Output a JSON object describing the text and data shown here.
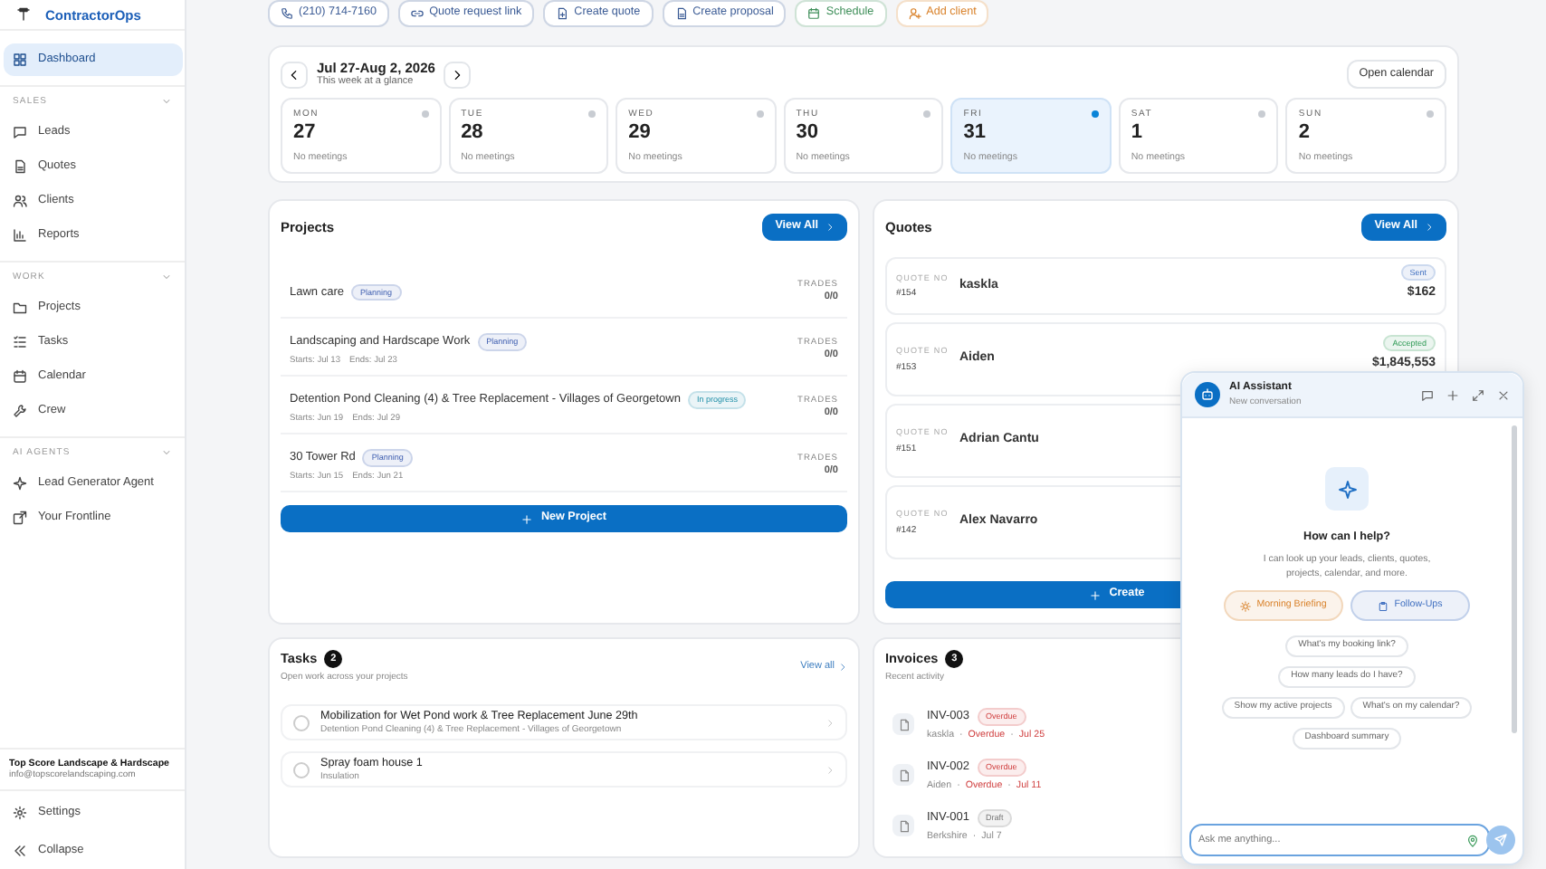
{
  "sidebar": {
    "brand": "ContractorOps",
    "top_items": [
      {
        "label": "Dashboard",
        "selected": true
      }
    ],
    "sections": [
      {
        "title": "SALES",
        "expanded": true,
        "items": [
          {
            "label": "Leads",
            "selected": false
          },
          {
            "label": "Quotes",
            "selected": false
          },
          {
            "label": "Clients",
            "selected": false
          },
          {
            "label": "Reports",
            "selected": false
          }
        ]
      },
      {
        "title": "WORK",
        "expanded": true,
        "items": [
          {
            "label": "Projects",
            "selected": false
          },
          {
            "label": "Tasks",
            "selected": false
          },
          {
            "label": "Calendar",
            "selected": false
          },
          {
            "label": "Crew",
            "selected": false
          }
        ]
      },
      {
        "title": "AI AGENTS",
        "expanded": true,
        "items": [
          {
            "label": "Lead Generator Agent",
            "selected": false
          },
          {
            "label": "Your Frontline",
            "selected": false
          }
        ]
      }
    ],
    "company": {
      "name": "Top Score Landscape & Hardscape",
      "email": "info@topscorelandscaping.com"
    },
    "footer_items": [
      "Settings",
      "Collapse"
    ]
  },
  "toolbar": [
    {
      "label": "(210) 714-7160",
      "color": "#3b5b95"
    },
    {
      "label": "Quote request link",
      "color": "#3b5b95"
    },
    {
      "label": "Create quote",
      "color": "#3b5b95"
    },
    {
      "label": "Create proposal",
      "color": "#3b5b95"
    },
    {
      "label": "Schedule",
      "color": "#3f8f5a"
    },
    {
      "label": "Add client",
      "color": "#d9822b"
    }
  ],
  "calendar": {
    "range": "Jul 27-Aug 2, 2026",
    "subtitle": "This week at a glance",
    "open_button": "Open calendar",
    "days": [
      {
        "day": "MON",
        "date": "27",
        "note": "No meetings",
        "selected": false
      },
      {
        "day": "TUE",
        "date": "28",
        "note": "No meetings",
        "selected": false
      },
      {
        "day": "WED",
        "date": "29",
        "note": "No meetings",
        "selected": false
      },
      {
        "day": "THU",
        "date": "30",
        "note": "No meetings",
        "selected": false
      },
      {
        "day": "FRI",
        "date": "31",
        "note": "No meetings",
        "selected": true
      },
      {
        "day": "SAT",
        "date": "1",
        "note": "No meetings",
        "selected": false
      },
      {
        "day": "SUN",
        "date": "2",
        "note": "No meetings",
        "selected": false
      }
    ]
  },
  "projects": {
    "title": "Projects",
    "view_all": "View All",
    "new_button": "New Project",
    "items": [
      {
        "name": "Lawn care",
        "status": "Planning",
        "kind": "planning",
        "trades_label": "TRADES",
        "trades": "0/0"
      },
      {
        "name": "Landscaping and Hardscape Work",
        "status": "Planning",
        "kind": "planning",
        "starts": "Starts: Jul 13",
        "ends": "Ends: Jul 23",
        "trades_label": "TRADES",
        "trades": "0/0"
      },
      {
        "name": "Detention Pond Cleaning (4) & Tree Replacement - Villages of Georgetown",
        "status": "In progress",
        "kind": "progress",
        "starts": "Starts: Jun 19",
        "ends": "Ends: Jul 29",
        "trades_label": "TRADES",
        "trades": "0/0"
      },
      {
        "name": "30 Tower Rd",
        "status": "Planning",
        "kind": "planning",
        "starts": "Starts: Jun 15",
        "ends": "Ends: Jun 21",
        "trades_label": "TRADES",
        "trades": "0/0"
      }
    ]
  },
  "quotes": {
    "title": "Quotes",
    "view_all": "View All",
    "create_button": "Create",
    "items": [
      {
        "label": "QUOTE NO",
        "number": "#154",
        "client": "kaskla",
        "status": "Sent",
        "kind": "sent",
        "amount": "$162"
      },
      {
        "label": "QUOTE NO",
        "number": "#153",
        "client": "Aiden",
        "status": "Accepted",
        "kind": "accepted",
        "amount": "$1,845,553"
      },
      {
        "label": "QUOTE NO",
        "number": "#151",
        "client": "Adrian Cantu"
      },
      {
        "label": "QUOTE NO",
        "number": "#142",
        "client": "Alex Navarro"
      }
    ]
  },
  "tasks": {
    "title": "Tasks",
    "count": "2",
    "subtitle": "Open work across your projects",
    "view_all": "View all",
    "items": [
      {
        "title": "Mobilization for Wet Pond work & Tree Replacement June 29th",
        "project": "Detention Pond Cleaning (4) & Tree Replacement - Villages of Georgetown",
        "checked": false
      },
      {
        "title": "Spray foam house 1",
        "project": "Insulation",
        "checked": false
      }
    ]
  },
  "invoices": {
    "title": "Invoices",
    "count": "3",
    "subtitle": "Recent activity",
    "items": [
      {
        "number": "INV-003",
        "status": "Overdue",
        "kind": "overdue",
        "client": "kaskla",
        "separator": "·",
        "due_note": "Overdue",
        "date": "Jul 25"
      },
      {
        "number": "INV-002",
        "status": "Overdue",
        "kind": "overdue",
        "client": "Aiden",
        "separator": "·",
        "due_note": "Overdue",
        "date": "Jul 11"
      },
      {
        "number": "INV-001",
        "status": "Draft",
        "kind": "draft",
        "client": "Berkshire",
        "separator": "·",
        "date": "Jul 7"
      }
    ]
  },
  "assistant": {
    "title": "AI Assistant",
    "subtitle": "New conversation",
    "heading": "How can I help?",
    "text": "I can look up your leads, clients, quotes, projects, calendar, and more.",
    "actions": [
      {
        "label": "Morning Briefing",
        "color": "#d9822b"
      },
      {
        "label": "Follow-Ups",
        "color": "#3f6fc0"
      }
    ],
    "suggestions": [
      [
        "What's my booking link?"
      ],
      [
        "How many leads do I have?"
      ],
      [
        "Show my active projects",
        "What's on my calendar?"
      ],
      [
        "Dashboard summary"
      ]
    ],
    "placeholder": "Ask me anything..."
  }
}
